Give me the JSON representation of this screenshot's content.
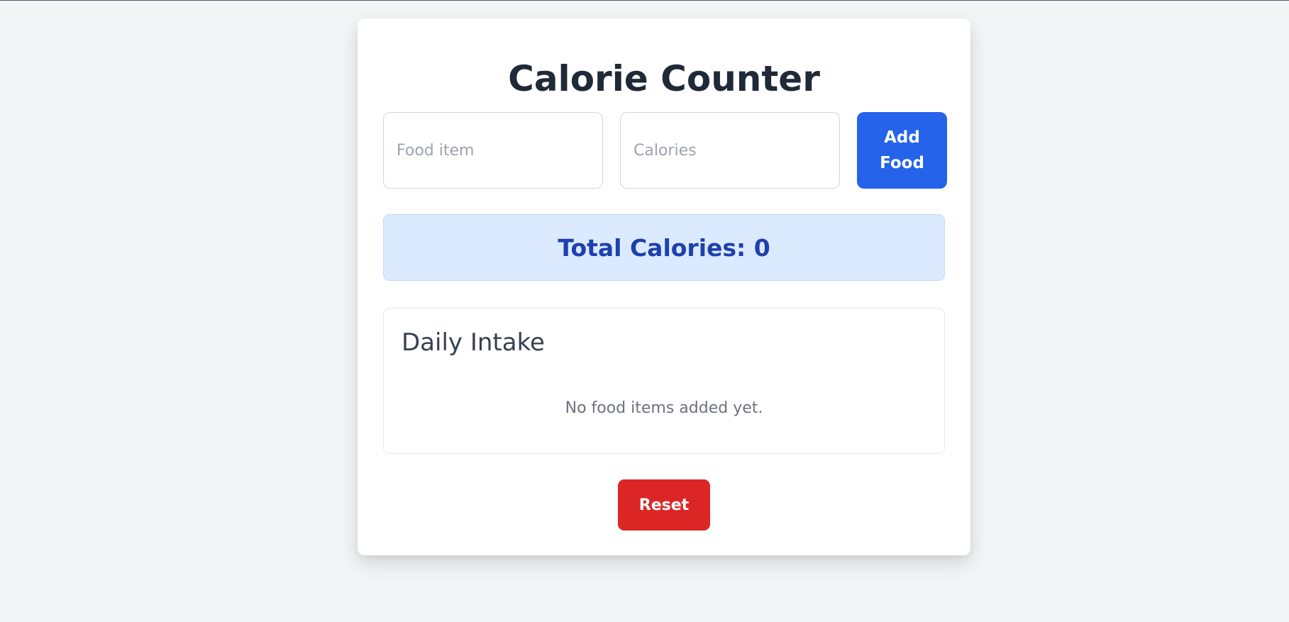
{
  "app": {
    "title": "Calorie Counter"
  },
  "form": {
    "food_placeholder": "Food item",
    "food_value": "",
    "calories_placeholder": "Calories",
    "calories_value": "",
    "add_label": "Add Food"
  },
  "summary": {
    "total_label": "Total Calories: 0",
    "total_value": 0
  },
  "intake": {
    "heading": "Daily Intake",
    "empty_message": "No food items added yet.",
    "items": []
  },
  "actions": {
    "reset_label": "Reset"
  },
  "colors": {
    "page_background": "#f3f4f6",
    "primary": "#2563eb",
    "danger": "#dc2626",
    "total_background": "#dbeafe",
    "total_text": "#1e40af"
  }
}
